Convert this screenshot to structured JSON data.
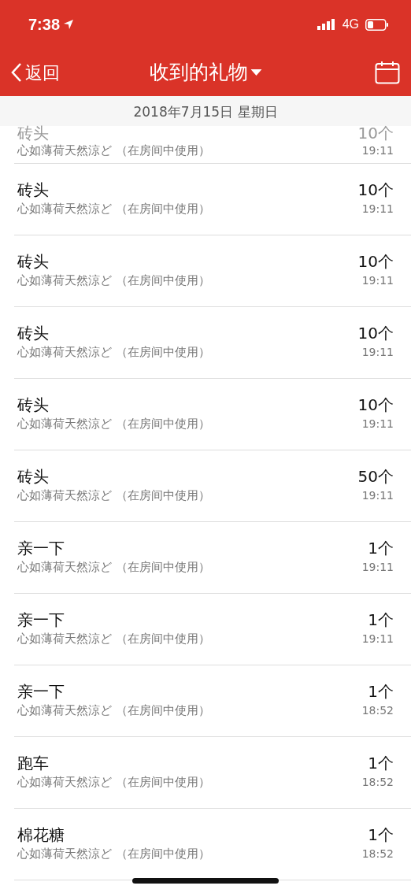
{
  "status_bar": {
    "time": "7:38",
    "network": "4G"
  },
  "nav": {
    "back": "返回",
    "title": "收到的礼物"
  },
  "date_header": "2018年7月15日 星期日",
  "gifts": [
    {
      "name": "砖头",
      "source": "心如薄荷天然涼ど （在房间中使用）",
      "count": "10个",
      "time": "19:11"
    },
    {
      "name": "砖头",
      "source": "心如薄荷天然涼ど （在房间中使用）",
      "count": "10个",
      "time": "19:11"
    },
    {
      "name": "砖头",
      "source": "心如薄荷天然涼ど （在房间中使用）",
      "count": "10个",
      "time": "19:11"
    },
    {
      "name": "砖头",
      "source": "心如薄荷天然涼ど （在房间中使用）",
      "count": "10个",
      "time": "19:11"
    },
    {
      "name": "砖头",
      "source": "心如薄荷天然涼ど （在房间中使用）",
      "count": "10个",
      "time": "19:11"
    },
    {
      "name": "砖头",
      "source": "心如薄荷天然涼ど （在房间中使用）",
      "count": "50个",
      "time": "19:11"
    },
    {
      "name": "亲一下",
      "source": "心如薄荷天然涼ど （在房间中使用）",
      "count": "1个",
      "time": "19:11"
    },
    {
      "name": "亲一下",
      "source": "心如薄荷天然涼ど （在房间中使用）",
      "count": "1个",
      "time": "19:11"
    },
    {
      "name": "亲一下",
      "source": "心如薄荷天然涼ど （在房间中使用）",
      "count": "1个",
      "time": "18:52"
    },
    {
      "name": "跑车",
      "source": "心如薄荷天然涼ど （在房间中使用）",
      "count": "1个",
      "time": "18:52"
    },
    {
      "name": "棉花糖",
      "source": "心如薄荷天然涼ど （在房间中使用）",
      "count": "1个",
      "time": "18:52"
    }
  ]
}
